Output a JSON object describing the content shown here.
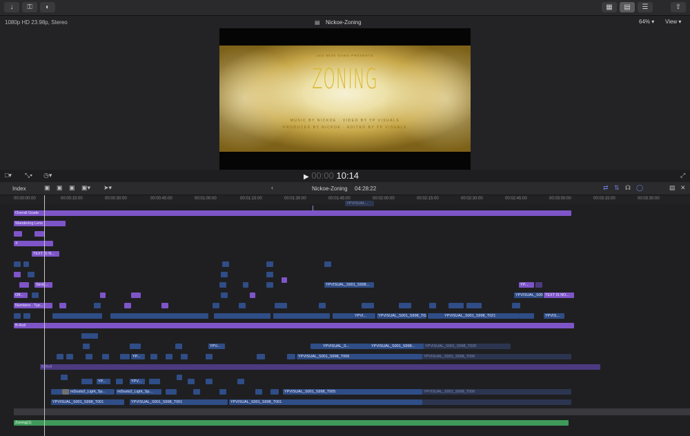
{
  "toolbar": {
    "import_icon": "download-arrow-icon",
    "keywords_icon": "key-icon",
    "background_tasks_icon": "background-tasks-icon",
    "layout_buttons": [
      "libraries-layout-icon",
      "browser-layout-icon",
      "inspector-layout-icon"
    ],
    "share_icon": "share-icon"
  },
  "viewer": {
    "format": "1080p HD 23.98p, Stereo",
    "project_title": "Nickoe-Zoning",
    "zoom": "64%",
    "view_menu": "View",
    "frame": {
      "presents": "LES MISE GANG PRESENTS",
      "title": "ZONING",
      "credit1": "MUSIC BY NICKOE · VIDEO BY YP VISUALS",
      "credit2": "PRODUCED BY NICKOE · EDITED BY YP VISUALS"
    }
  },
  "transport": {
    "timecode_dim": "00:00",
    "timecode": "10:14"
  },
  "timeline": {
    "index_label": "Index",
    "project_name": "Nickoe-Zoning",
    "duration": "04:28:22",
    "ruler": [
      "00:00:00:00",
      "00:00:15:00",
      "00:00:30:00",
      "00:00:45:00",
      "00:01:00:00",
      "00:01:15:00",
      "00:01:30:00",
      "00:01:45:00",
      "00:02:00:00",
      "00:02:15:00",
      "00:02:30:00",
      "00:02:45:00",
      "00:03:00:00",
      "00:03:15:00",
      "00:03:30:00"
    ],
    "clips": {
      "overall_grade": "Overall Grade",
      "wandering_lens": "Wandering Lens",
      "x": "X",
      "text_is_n": "TEXT IS N...",
      "off": "Off...",
      "numbers": "Numbers - Typ...",
      "strob": "Strob...",
      "ypvisual_s001_s998": "YPVISUAL_S001_S998...",
      "text_is_no": "TEXT IS NO...",
      "ypvisual_1": "YPVISUAL_S001_S998_T021",
      "ypvisual_ellipsis": "YPVISUAL_S001_S998...",
      "ypvi": "YPVI...",
      "ypvis": "YPVIS...",
      "yp": "YP...",
      "b_roll": "B-Roll",
      "t020": "YPVISUAL_S001_S998_T020",
      "t006a": "YPVISUAL_S001_S998_T006",
      "t006b": "YPVISUAL_S001_S998_T006",
      "yp_short": "YPV...",
      "ypvisual_s": "YPVISUAL_S...",
      "b_roll2": "B-Roll",
      "mdusts1": "mDusts2_Light_Sp...",
      "mdusts2": "mDusts2_Light_Sp...",
      "t005": "YPVISUAL_S001_S998_T005",
      "t006c": "YPVISUAL_S001_S998_T006",
      "t001a": "YPVISUAL_S001_S998_T001",
      "t001b": "YPVISUAL_S001_S998_T001",
      "t001c": "YPVISUAL_S001_S998_T001",
      "zoning": "Zoning(1)",
      "ypvisual_top": "YPVISUAL...",
      "yvisual": "YPVISUAL_S001_S998..."
    }
  }
}
